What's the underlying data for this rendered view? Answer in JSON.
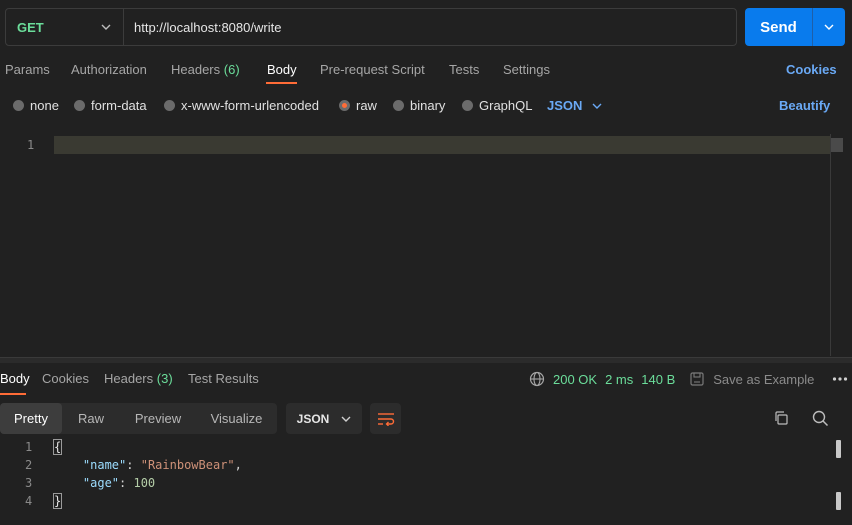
{
  "request": {
    "method": "GET",
    "url": "http://localhost:8080/write",
    "send_label": "Send"
  },
  "req_tabs": {
    "params": "Params",
    "authorization": "Authorization",
    "headers": "Headers",
    "headers_count": "(6)",
    "body": "Body",
    "prerequest": "Pre-request Script",
    "tests": "Tests",
    "settings": "Settings",
    "cookies": "Cookies"
  },
  "body_types": {
    "none": "none",
    "form_data": "form-data",
    "urlencoded": "x-www-form-urlencoded",
    "raw": "raw",
    "binary": "binary",
    "graphql": "GraphQL",
    "selected": "raw",
    "language": "JSON",
    "beautify": "Beautify"
  },
  "editor": {
    "line_numbers": [
      "1"
    ]
  },
  "response": {
    "tabs": {
      "body": "Body",
      "cookies": "Cookies",
      "headers": "Headers",
      "headers_count": "(3)",
      "test_results": "Test Results"
    },
    "status": "200 OK",
    "time": "2 ms",
    "size": "140 B",
    "save_example": "Save as Example",
    "views": {
      "pretty": "Pretty",
      "raw": "Raw",
      "preview": "Preview",
      "visualize": "Visualize"
    },
    "format": "JSON",
    "code": {
      "open": "{",
      "name_key": "\"name\"",
      "name_value": "\"RainbowBear\"",
      "age_key": "\"age\"",
      "age_value": "100",
      "close": "}",
      "line_numbers": [
        "1",
        "2",
        "3",
        "4"
      ]
    }
  },
  "colors": {
    "accent": "#ff6c37",
    "send": "#097bed",
    "method": "#6bdd9a",
    "link": "#6aa9f5"
  }
}
